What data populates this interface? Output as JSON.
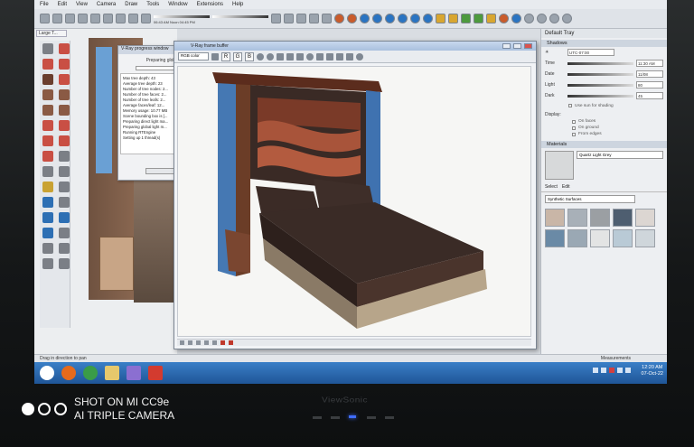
{
  "menu": [
    "File",
    "Edit",
    "View",
    "Camera",
    "Draw",
    "Tools",
    "Window",
    "Extensions",
    "Help"
  ],
  "toolbar": {
    "slider_ticks": "06:43 AM   Noon   04:45 PM"
  },
  "document": {
    "tab_label": "Large T..."
  },
  "progress_dialog": {
    "title": "V-Ray progress window",
    "status": "Preparing glob...",
    "log": [
      "Max tree depth: 43",
      "Average tree depth: 23",
      "Number of tree nodes: 2...",
      "Number of tree faces: 2...",
      "Number of tree leafs: 2...",
      "Average faces/leaf: 12...",
      "Memory usage: 10.77 MB",
      "Scene bounding box is [...",
      "Preparing direct light ma...",
      "Preparing global light m...",
      "Running RTEngine",
      "Setting up 1 thread(s)"
    ]
  },
  "frame_buffer": {
    "title": "V-Ray frame buffer",
    "channel_select": "RGB color",
    "channels": [
      "R",
      "G",
      "B"
    ]
  },
  "tray": {
    "title": "Default Tray",
    "shadows": {
      "heading": "Shadows",
      "timezone": "UTC-07:00",
      "time_label": "Time",
      "time_value": "11:30 AM",
      "date_label": "Date",
      "date_value": "11/08",
      "light_label": "Light",
      "light_value": "80",
      "dark_label": "Dark",
      "dark_value": "45",
      "use_sun": "Use sun for shading",
      "display_label": "Display:",
      "on_faces": "On faces",
      "on_ground": "On ground",
      "from_edges": "From edges"
    },
    "materials": {
      "heading": "Materials",
      "current": "Quartz Light Grey",
      "tab_select": "Select",
      "tab_edit": "Edit",
      "library": "Synthetic Surfaces",
      "swatch_colors": [
        "#c9b6a7",
        "#a8b0b8",
        "#9b9fa3",
        "#4e5e70",
        "#dcd6d2",
        "#6a8aa6",
        "#9aa8b4",
        "#e3e4e4",
        "#b9cad6",
        "#cfd6db"
      ]
    }
  },
  "status_bar": {
    "hint": "Drag in direction to pan",
    "measurements": "Measurements"
  },
  "taskbar": {
    "clock_time": "12:20 AM",
    "clock_date": "07-Oct-22"
  },
  "monitor_brand": "ViewSonic",
  "watermark": {
    "line1": "SHOT ON MI CC9e",
    "line2": "AI TRIPLE CAMERA"
  }
}
